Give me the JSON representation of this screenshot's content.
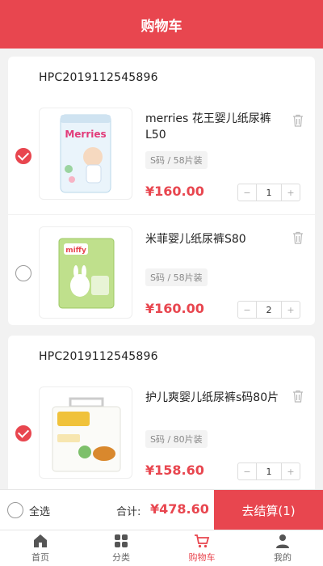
{
  "header": {
    "title": "购物车"
  },
  "stores": [
    {
      "order_no": "HPC2019112545896",
      "items": [
        {
          "name": "merries 花王婴儿纸尿裤L50",
          "spec": "S码 / 58片装",
          "price": "¥160.00",
          "qty": "1",
          "selected": true,
          "image_brand": "Merries"
        },
        {
          "name": "米菲婴儿纸尿裤S80",
          "spec": "S码 / 58片装",
          "price": "¥160.00",
          "qty": "2",
          "selected": false,
          "image_brand": "miffy"
        }
      ]
    },
    {
      "order_no": "HPC2019112545896",
      "items": [
        {
          "name": "护儿爽婴儿纸尿裤s码80片",
          "spec": "S码 / 80片装",
          "price": "¥158.60",
          "qty": "1",
          "selected": true,
          "image_brand": ""
        }
      ]
    }
  ],
  "stepper": {
    "minus": "−",
    "plus": "+"
  },
  "checkout": {
    "select_all_label": "全选",
    "total_label": "合计:",
    "total_value": "¥478.60",
    "settle_label": "去结算(1)"
  },
  "tabbar": [
    {
      "label": "首页",
      "icon": "home-icon",
      "active": false
    },
    {
      "label": "分类",
      "icon": "grid-icon",
      "active": false
    },
    {
      "label": "购物车",
      "icon": "cart-icon",
      "active": true
    },
    {
      "label": "我的",
      "icon": "user-icon",
      "active": false
    }
  ],
  "colors": {
    "accent": "#e8464f",
    "background": "#f2f2f2"
  }
}
